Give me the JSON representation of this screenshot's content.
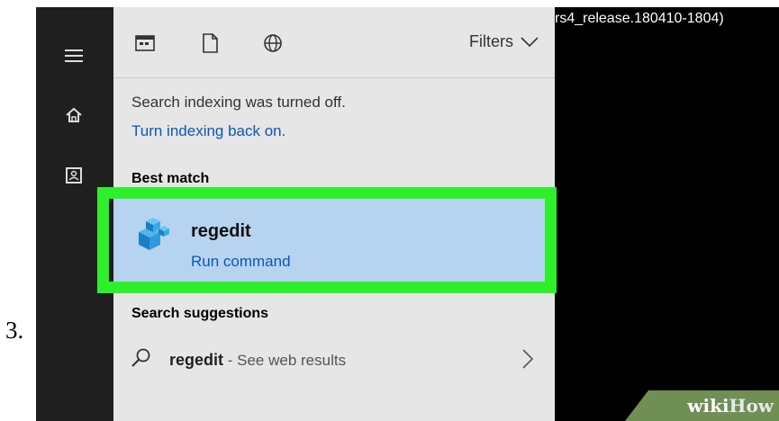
{
  "step": {
    "number": "3."
  },
  "rail": {
    "icons": [
      "hamburger-icon",
      "home-icon",
      "document-icon"
    ]
  },
  "topbar": {
    "icons": [
      "apps-icon",
      "document-icon",
      "web-icon"
    ],
    "filters_label": "Filters"
  },
  "notice": {
    "text": "Search indexing was turned off.",
    "link": "Turn indexing back on."
  },
  "best_match": {
    "section_label": "Best match",
    "name": "regedit",
    "subtitle": "Run command"
  },
  "suggestions": {
    "section_label": "Search suggestions",
    "items": [
      {
        "query": "regedit",
        "suffix": " - See web results"
      }
    ]
  },
  "background": {
    "build_text": "rs4_release.180410-1804)"
  },
  "watermark": {
    "part1": "wiki",
    "part2": "How"
  },
  "colors": {
    "highlight": "#2ef02a",
    "selection": "#b6d4f0",
    "link": "#0b58b5",
    "panel": "#e6e6e6",
    "rail": "#1f1f1f"
  }
}
